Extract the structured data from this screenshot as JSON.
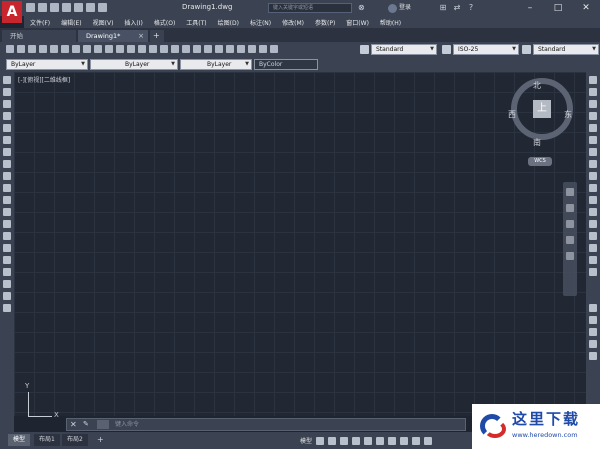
{
  "title_bar": {
    "doc_title": "Drawing1.dwg",
    "search_placeholder": "键入关键字或短语",
    "signin_label": "登录",
    "help_label": "?"
  },
  "menu": [
    "文件(F)",
    "编辑(E)",
    "视图(V)",
    "插入(I)",
    "格式(O)",
    "工具(T)",
    "绘图(D)",
    "标注(N)",
    "修改(M)",
    "参数(P)",
    "窗口(W)",
    "帮助(H)"
  ],
  "tabs": {
    "start": "开始",
    "drawing": "Drawing1*",
    "add": "+"
  },
  "toolbar": {
    "text_style": "Standard",
    "dim_style": "ISO-25",
    "table_style": "Standard",
    "layer": "ByLayer",
    "linetype": "ByLayer",
    "lineweight": "ByLayer",
    "plot_style": "ByColor"
  },
  "viewport": {
    "label": "[-][俯视][二维线框]"
  },
  "viewcube": {
    "north": "北",
    "south": "南",
    "west": "西",
    "east": "东",
    "top": "上",
    "wcs": "WCS"
  },
  "ucs": {
    "x": "X",
    "y": "Y"
  },
  "command_line": {
    "placeholder": "键入命令"
  },
  "layout_tabs": {
    "model": "模型",
    "layout1": "布局1",
    "layout2": "布局2",
    "add": "+"
  },
  "status_bar": {
    "model_label": "模型"
  },
  "watermark": {
    "name": "这里下载",
    "url": "www.heredown.com"
  }
}
